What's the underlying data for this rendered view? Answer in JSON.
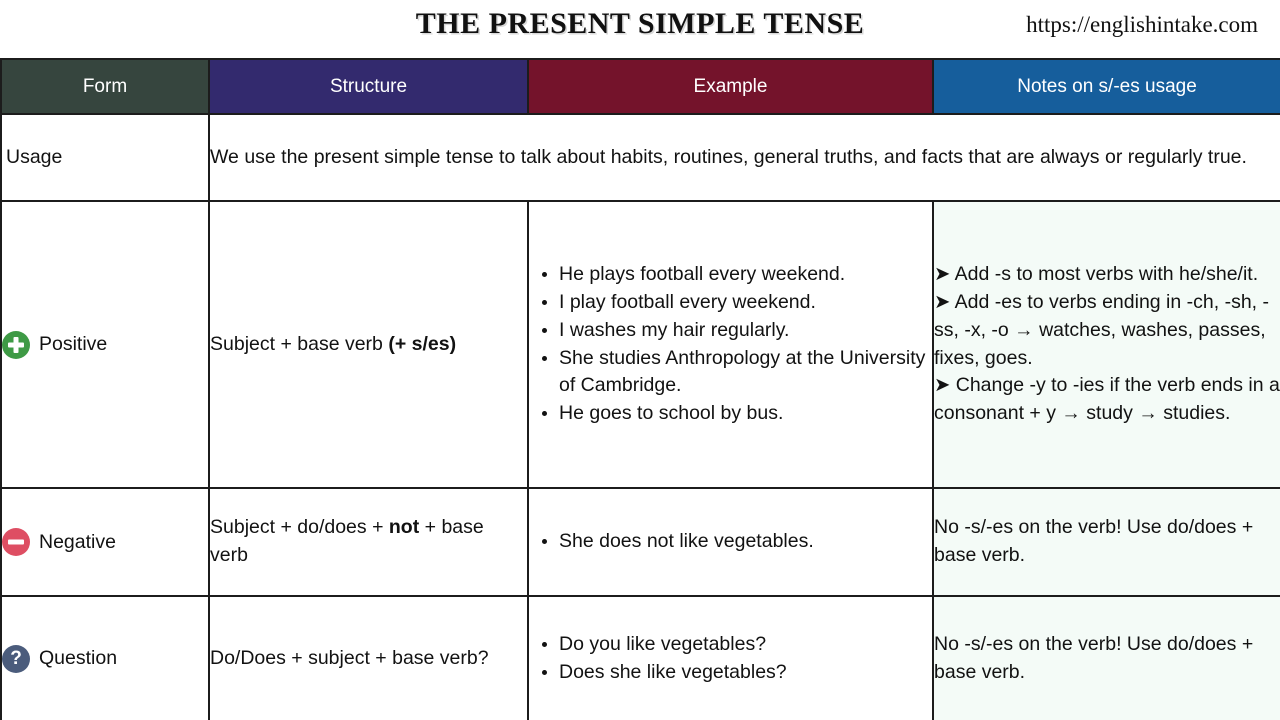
{
  "header": {
    "title": "THE PRESENT SIMPLE TENSE",
    "url": "https://englishintake.com"
  },
  "table": {
    "columns": [
      {
        "label": "Form",
        "color": "#36453e"
      },
      {
        "label": "Structure",
        "color": "#332a6e"
      },
      {
        "label": "Example",
        "color": "#74132b"
      },
      {
        "label": "Notes on s/-es usage",
        "color": "#165e9c"
      }
    ],
    "usage": {
      "label": "Usage",
      "text": "We use the present simple tense to talk about habits, routines, general truths, and facts that are always or regularly true."
    },
    "rows": [
      {
        "form": "Positive",
        "icon": "plus-circle-icon",
        "icon_color": "#3e9a45",
        "structure_plain": "Subject + base verb ",
        "structure_bold": "(+ s/es)",
        "structure_tail": "",
        "examples": [
          "He plays football every weekend.",
          "I play football every weekend.",
          "I washes my hair regularly.",
          "She studies Anthropology at the University of Cambridge.",
          "He goes to school by bus."
        ],
        "notes": [
          "➤ Add -s to most verbs with he/she/it.",
          "➤ Add -es to verbs ending in -ch, -sh, -ss, -x, -o → watches, washes, passes, fixes, goes.",
          "➤ Change -y to -ies if the verb ends in a consonant + y → study → studies."
        ]
      },
      {
        "form": "Negative",
        "icon": "minus-circle-icon",
        "icon_color": "#de4e63",
        "structure_plain": "Subject + do/does + ",
        "structure_bold": "not",
        "structure_tail": " + base verb",
        "examples": [
          "She does not like vegetables."
        ],
        "notes": [
          "No -s/-es on the verb! Use do/does + base verb."
        ]
      },
      {
        "form": "Question",
        "icon": "question-circle-icon",
        "icon_color": "#4b5c7c",
        "structure_plain": "Do/Does + subject + base verb?",
        "structure_bold": "",
        "structure_tail": "",
        "examples": [
          "Do you like vegetables?",
          "Does she like vegetables?"
        ],
        "notes": [
          "No -s/-es on the verb! Use do/does + base verb."
        ]
      }
    ]
  }
}
